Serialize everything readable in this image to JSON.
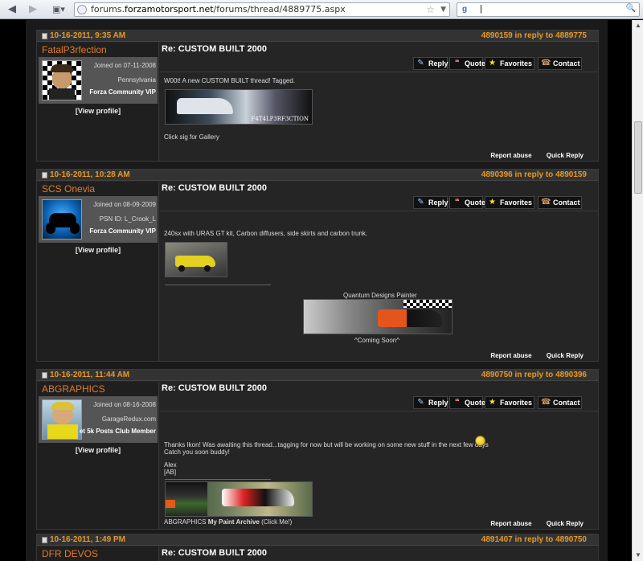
{
  "browser": {
    "url_prefix": "forums.",
    "url_domain": "forzamotorsport.net",
    "url_path": "/forums/thread/4889775.aspx",
    "search_value": "|"
  },
  "toolbar_labels": {
    "reply": "Reply",
    "quote": "Quote",
    "favorites": "Favorites",
    "contact": "Contact"
  },
  "footer_labels": {
    "report": "Report abuse",
    "quick_reply": "Quick Reply"
  },
  "view_profile": "[View profile]",
  "posts": [
    {
      "date": "10-16-2011, 9:35 AM",
      "reply_info": "4890159 in reply to 4889775",
      "username": "FatalP3rfection",
      "joined": "Joined on 07-11-2008",
      "location": "Pennsylvania",
      "rank": "Forza Community VIP",
      "title": "Re: CUSTOM BU!LT 2000",
      "body": [
        "W00t! A new CUSTOM BUILT thread! Tagged."
      ],
      "sig_text": "F4T4LP3RF3CTION",
      "after_text": "Click sig for Gallery"
    },
    {
      "date": "10-16-2011, 10:28 AM",
      "reply_info": "4890396 in reply to 4890159",
      "username": "SCS Onevia",
      "joined": "Joined on 08-09-2009",
      "location": "PSN ID: L_Crook_L",
      "rank": "Forza Community VIP",
      "title": "Re: CUSTOM BU!LT 2000",
      "body": [
        "240sx with URAS GT kit, Carbon diffusers, side skirts and carbon trunk."
      ],
      "sig_caption": "Quantum Designs Painter",
      "sig_sub": "^Coming Soon^"
    },
    {
      "date": "10-16-2011, 11:44 AM",
      "reply_info": "4890750 in reply to 4890396",
      "username": "ABGRAPHICS",
      "joined": "Joined on 08-16-2008",
      "location": "GarageRedux.com",
      "rank": "et 5k Posts Club Member",
      "title": "Re: CUSTOM BU!LT 2000",
      "body": [
        "Thanks Ikon! Was awaiting this thread...tagging for now but will be working on some new stuff in the next few days",
        "Catch you soon buddy!",
        "Alex",
        "[AB]"
      ],
      "sig_link_a": "ABGRAPHICS ",
      "sig_link_b": "My Paint Archive",
      "sig_link_c": " (Click Me!)"
    },
    {
      "date": "10-16-2011, 1:49 PM",
      "reply_info": "4891407 in reply to 4890750",
      "username": "DFR DEVOS",
      "title": "Re: CUSTOM BU!LT 2000"
    }
  ]
}
